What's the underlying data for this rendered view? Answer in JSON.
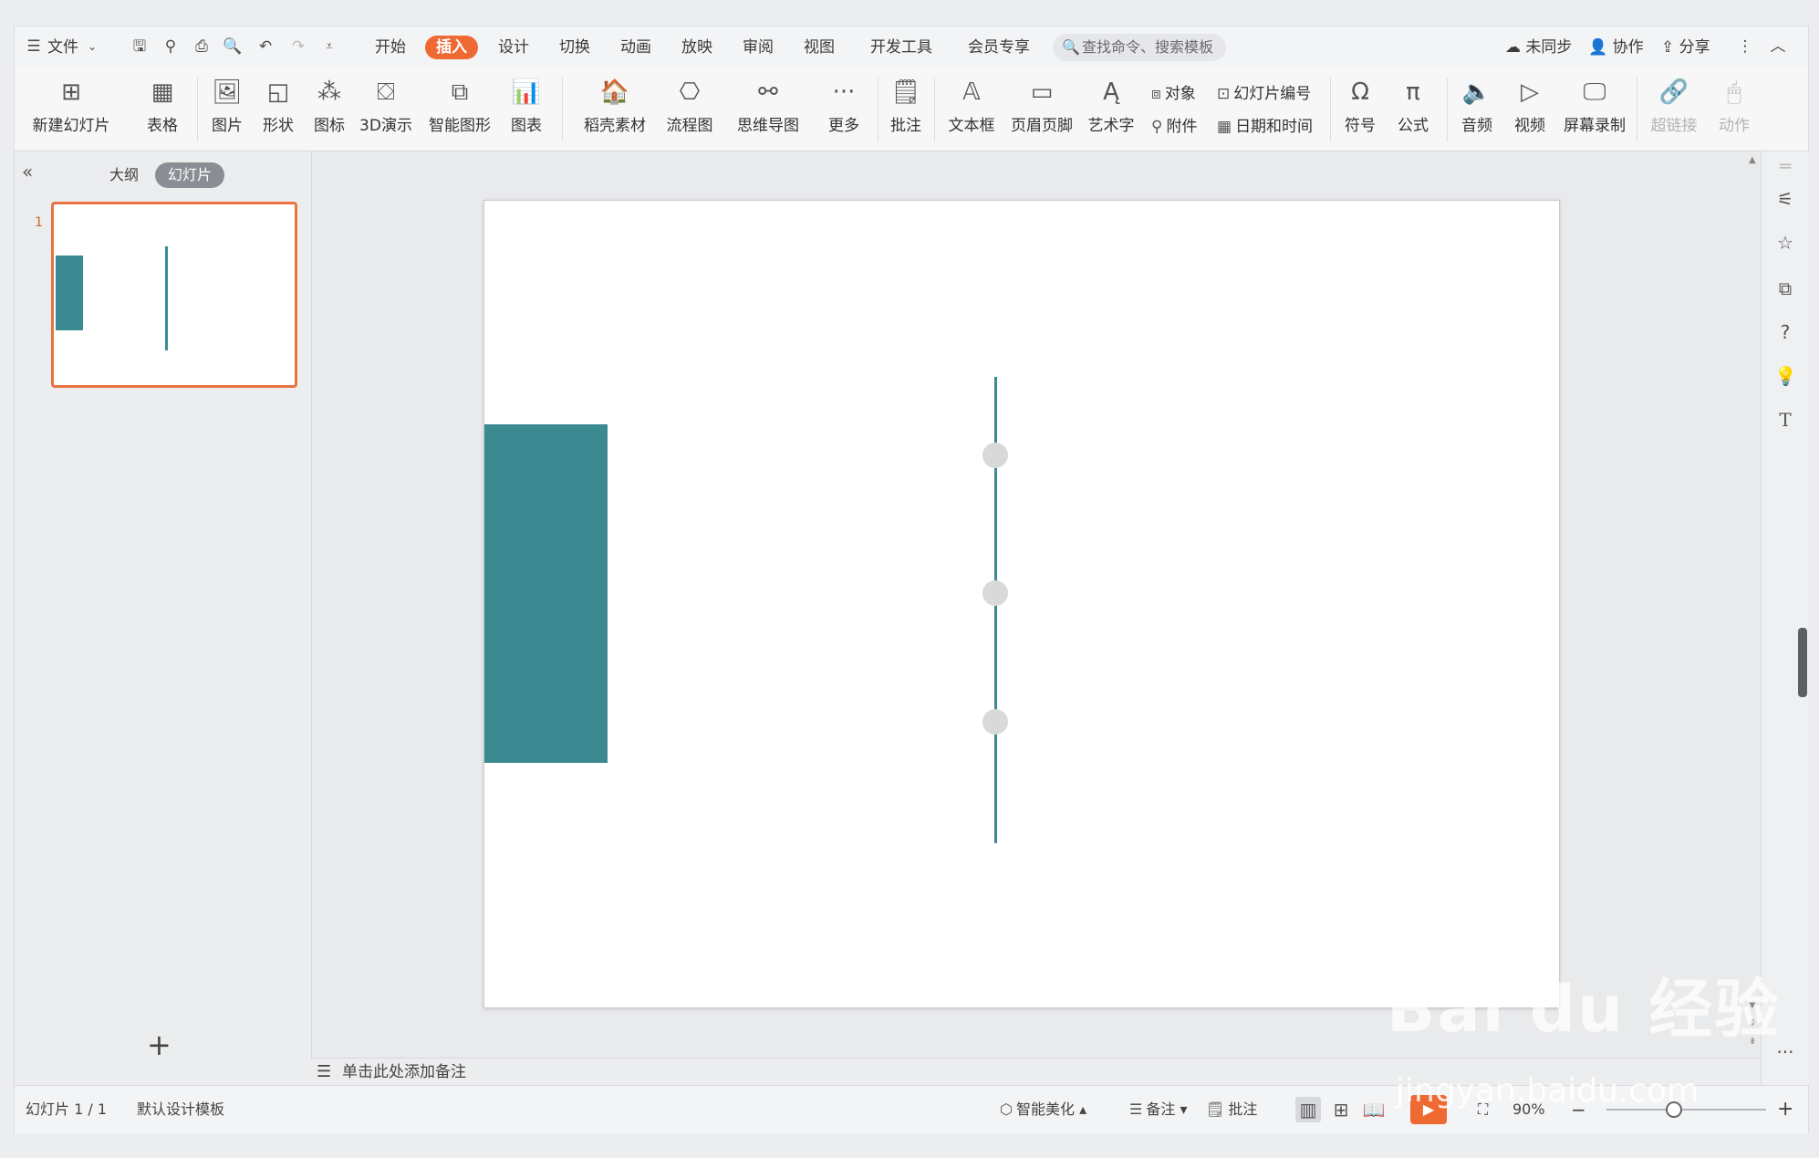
{
  "menubar": {
    "file_menu": "文件",
    "tabs": [
      "开始",
      "插入",
      "设计",
      "切换",
      "动画",
      "放映",
      "审阅",
      "视图",
      "开发工具",
      "会员专享"
    ],
    "active_tab": "插入",
    "search_placeholder": "查找命令、搜索模板",
    "sync_status": "未同步",
    "collaborate": "协作",
    "share": "分享"
  },
  "ribbon": {
    "new_slide": "新建幻灯片",
    "table": "表格",
    "picture": "图片",
    "shape": "形状",
    "icon": "图标",
    "3d": "3D演示",
    "smartart": "智能图形",
    "chart": "图表",
    "material": "稻壳素材",
    "flowchart": "流程图",
    "mindmap": "思维导图",
    "more": "更多",
    "comment": "批注",
    "textbox": "文本框",
    "header_footer": "页眉页脚",
    "wordart": "艺术字",
    "object": "对象",
    "attachment": "附件",
    "slide_number": "幻灯片编号",
    "date_time": "日期和时间",
    "symbol": "符号",
    "formula": "公式",
    "audio": "音频",
    "video": "视频",
    "screen_record": "屏幕录制",
    "hyperlink": "超链接",
    "action": "动作"
  },
  "left_panel": {
    "outline_tab": "大纲",
    "slides_tab": "幻灯片",
    "thumb_number": "1"
  },
  "notes": {
    "placeholder": "单击此处添加备注"
  },
  "status": {
    "slide_counter": "幻灯片 1 / 1",
    "template": "默认设计模板",
    "beautify": "智能美化",
    "notes": "备注",
    "comments": "批注",
    "zoom": "90%"
  },
  "watermark": {
    "logo": "Bai du 经验",
    "url": "jingyan.baidu.com"
  },
  "colors": {
    "accent": "#ef6a33",
    "teal": "#3b8a92",
    "dot": "#d9d9d9"
  }
}
